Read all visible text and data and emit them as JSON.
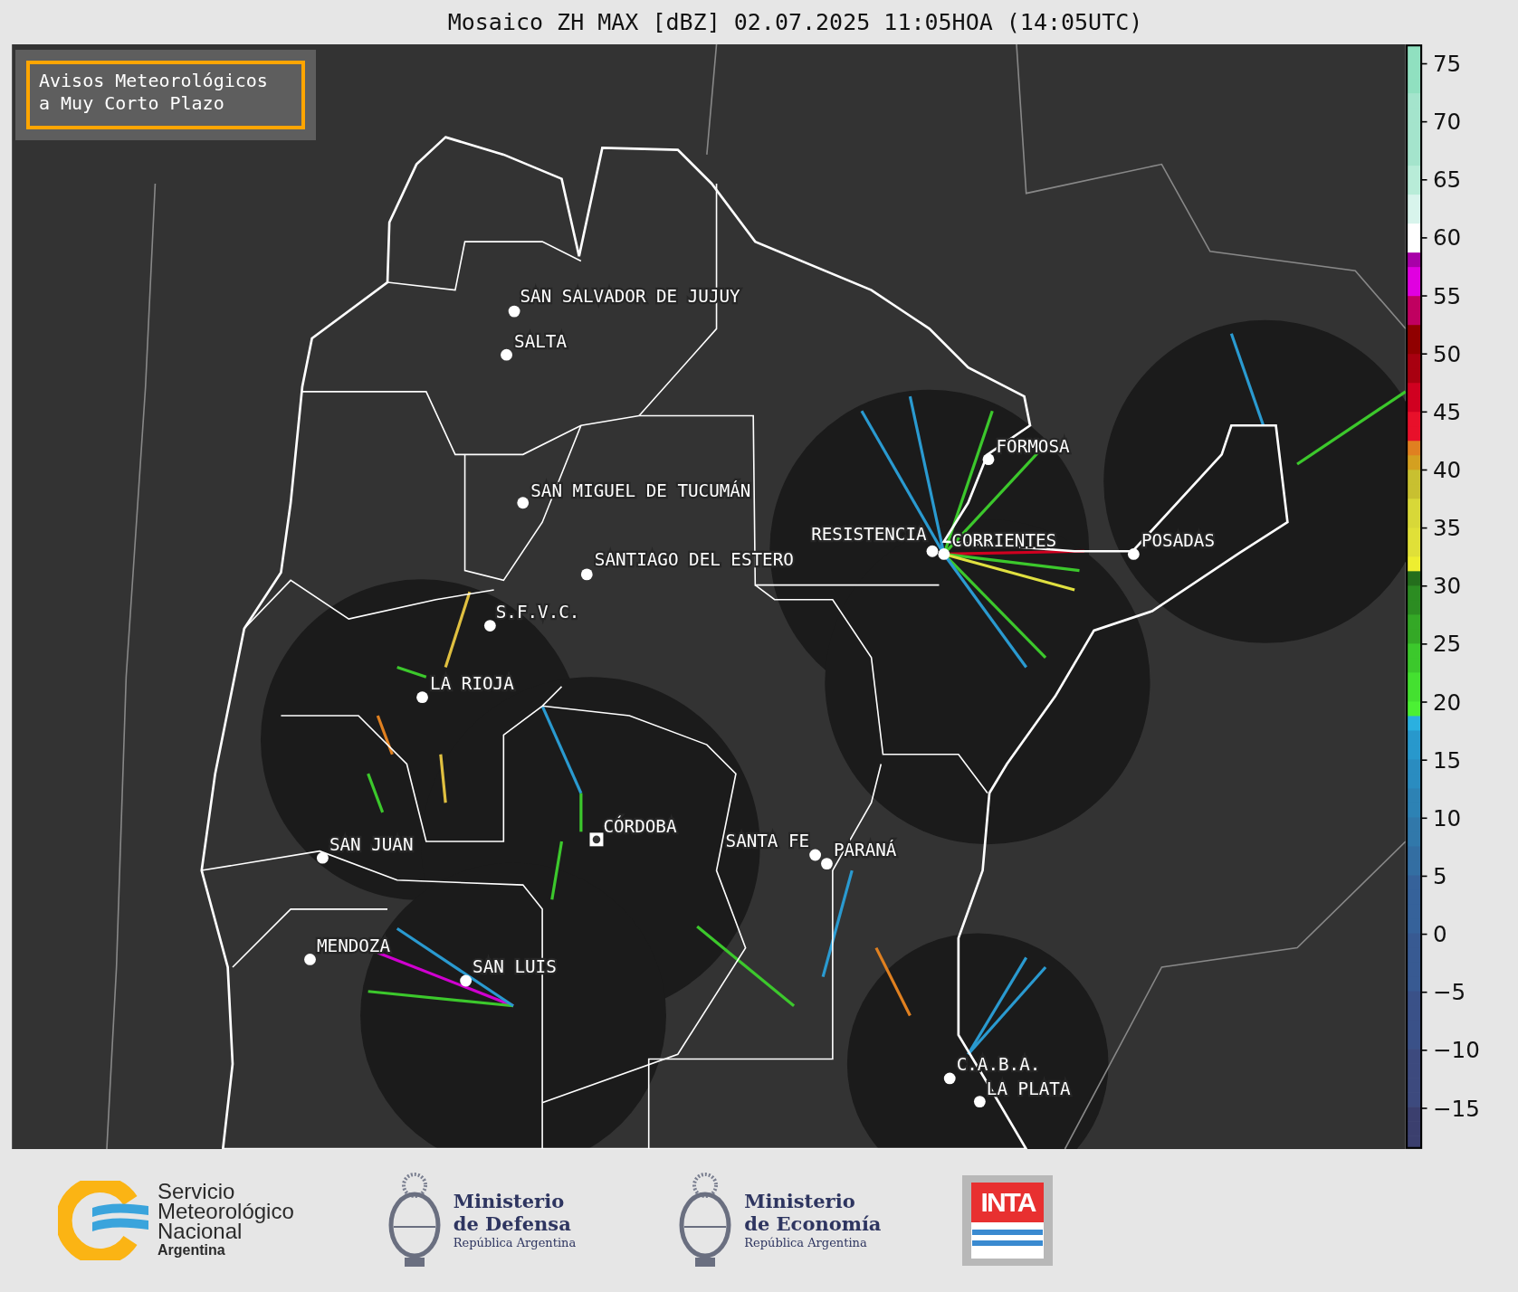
{
  "title": "Mosaico ZH MAX [dBZ] 02.07.2025 11:05HOA (14:05UTC)",
  "alert_box": {
    "lines": [
      "Avisos Meteorológicos",
      "a Muy Corto Plazo"
    ]
  },
  "cities": [
    {
      "name": "SAN SALVADOR DE JUJUY",
      "kind": "dot"
    },
    {
      "name": "SALTA",
      "kind": "dot"
    },
    {
      "name": "FORMOSA",
      "kind": "dot"
    },
    {
      "name": "SAN MIGUEL DE TUCUMÁN",
      "kind": "dot"
    },
    {
      "name": "RESISTENCIA",
      "kind": "dot"
    },
    {
      "name": "CORRIENTES",
      "kind": "dot"
    },
    {
      "name": "POSADAS",
      "kind": "dot"
    },
    {
      "name": "SANTIAGO DEL ESTERO",
      "kind": "dot"
    },
    {
      "name": "S.F.V.C.",
      "kind": "dot"
    },
    {
      "name": "LA RIOJA",
      "kind": "dot"
    },
    {
      "name": "CÓRDOBA",
      "kind": "square"
    },
    {
      "name": "SAN JUAN",
      "kind": "dot"
    },
    {
      "name": "SANTA FE",
      "kind": "dot"
    },
    {
      "name": "PARANÁ",
      "kind": "dot"
    },
    {
      "name": "MENDOZA",
      "kind": "dot"
    },
    {
      "name": "SAN LUIS",
      "kind": "dot"
    },
    {
      "name": "C.A.B.A.",
      "kind": "dot"
    },
    {
      "name": "LA PLATA",
      "kind": "dot"
    }
  ],
  "colorbar": {
    "ticks": [
      "75",
      "70",
      "65",
      "60",
      "55",
      "50",
      "45",
      "40",
      "35",
      "30",
      "25",
      "20",
      "15",
      "10",
      "5",
      "0",
      "−5",
      "−10",
      "−15"
    ]
  },
  "logos": [
    {
      "kind": "smn",
      "lines": [
        "Servicio",
        "Meteorológico",
        "Nacional",
        "Argentina"
      ]
    },
    {
      "kind": "ministry",
      "lines": [
        "Ministerio",
        "de Defensa",
        "República Argentina"
      ]
    },
    {
      "kind": "ministry",
      "lines": [
        "Ministerio",
        "de Economía",
        "República Argentina"
      ]
    },
    {
      "kind": "inta",
      "lines": [
        "INTA"
      ]
    }
  ]
}
